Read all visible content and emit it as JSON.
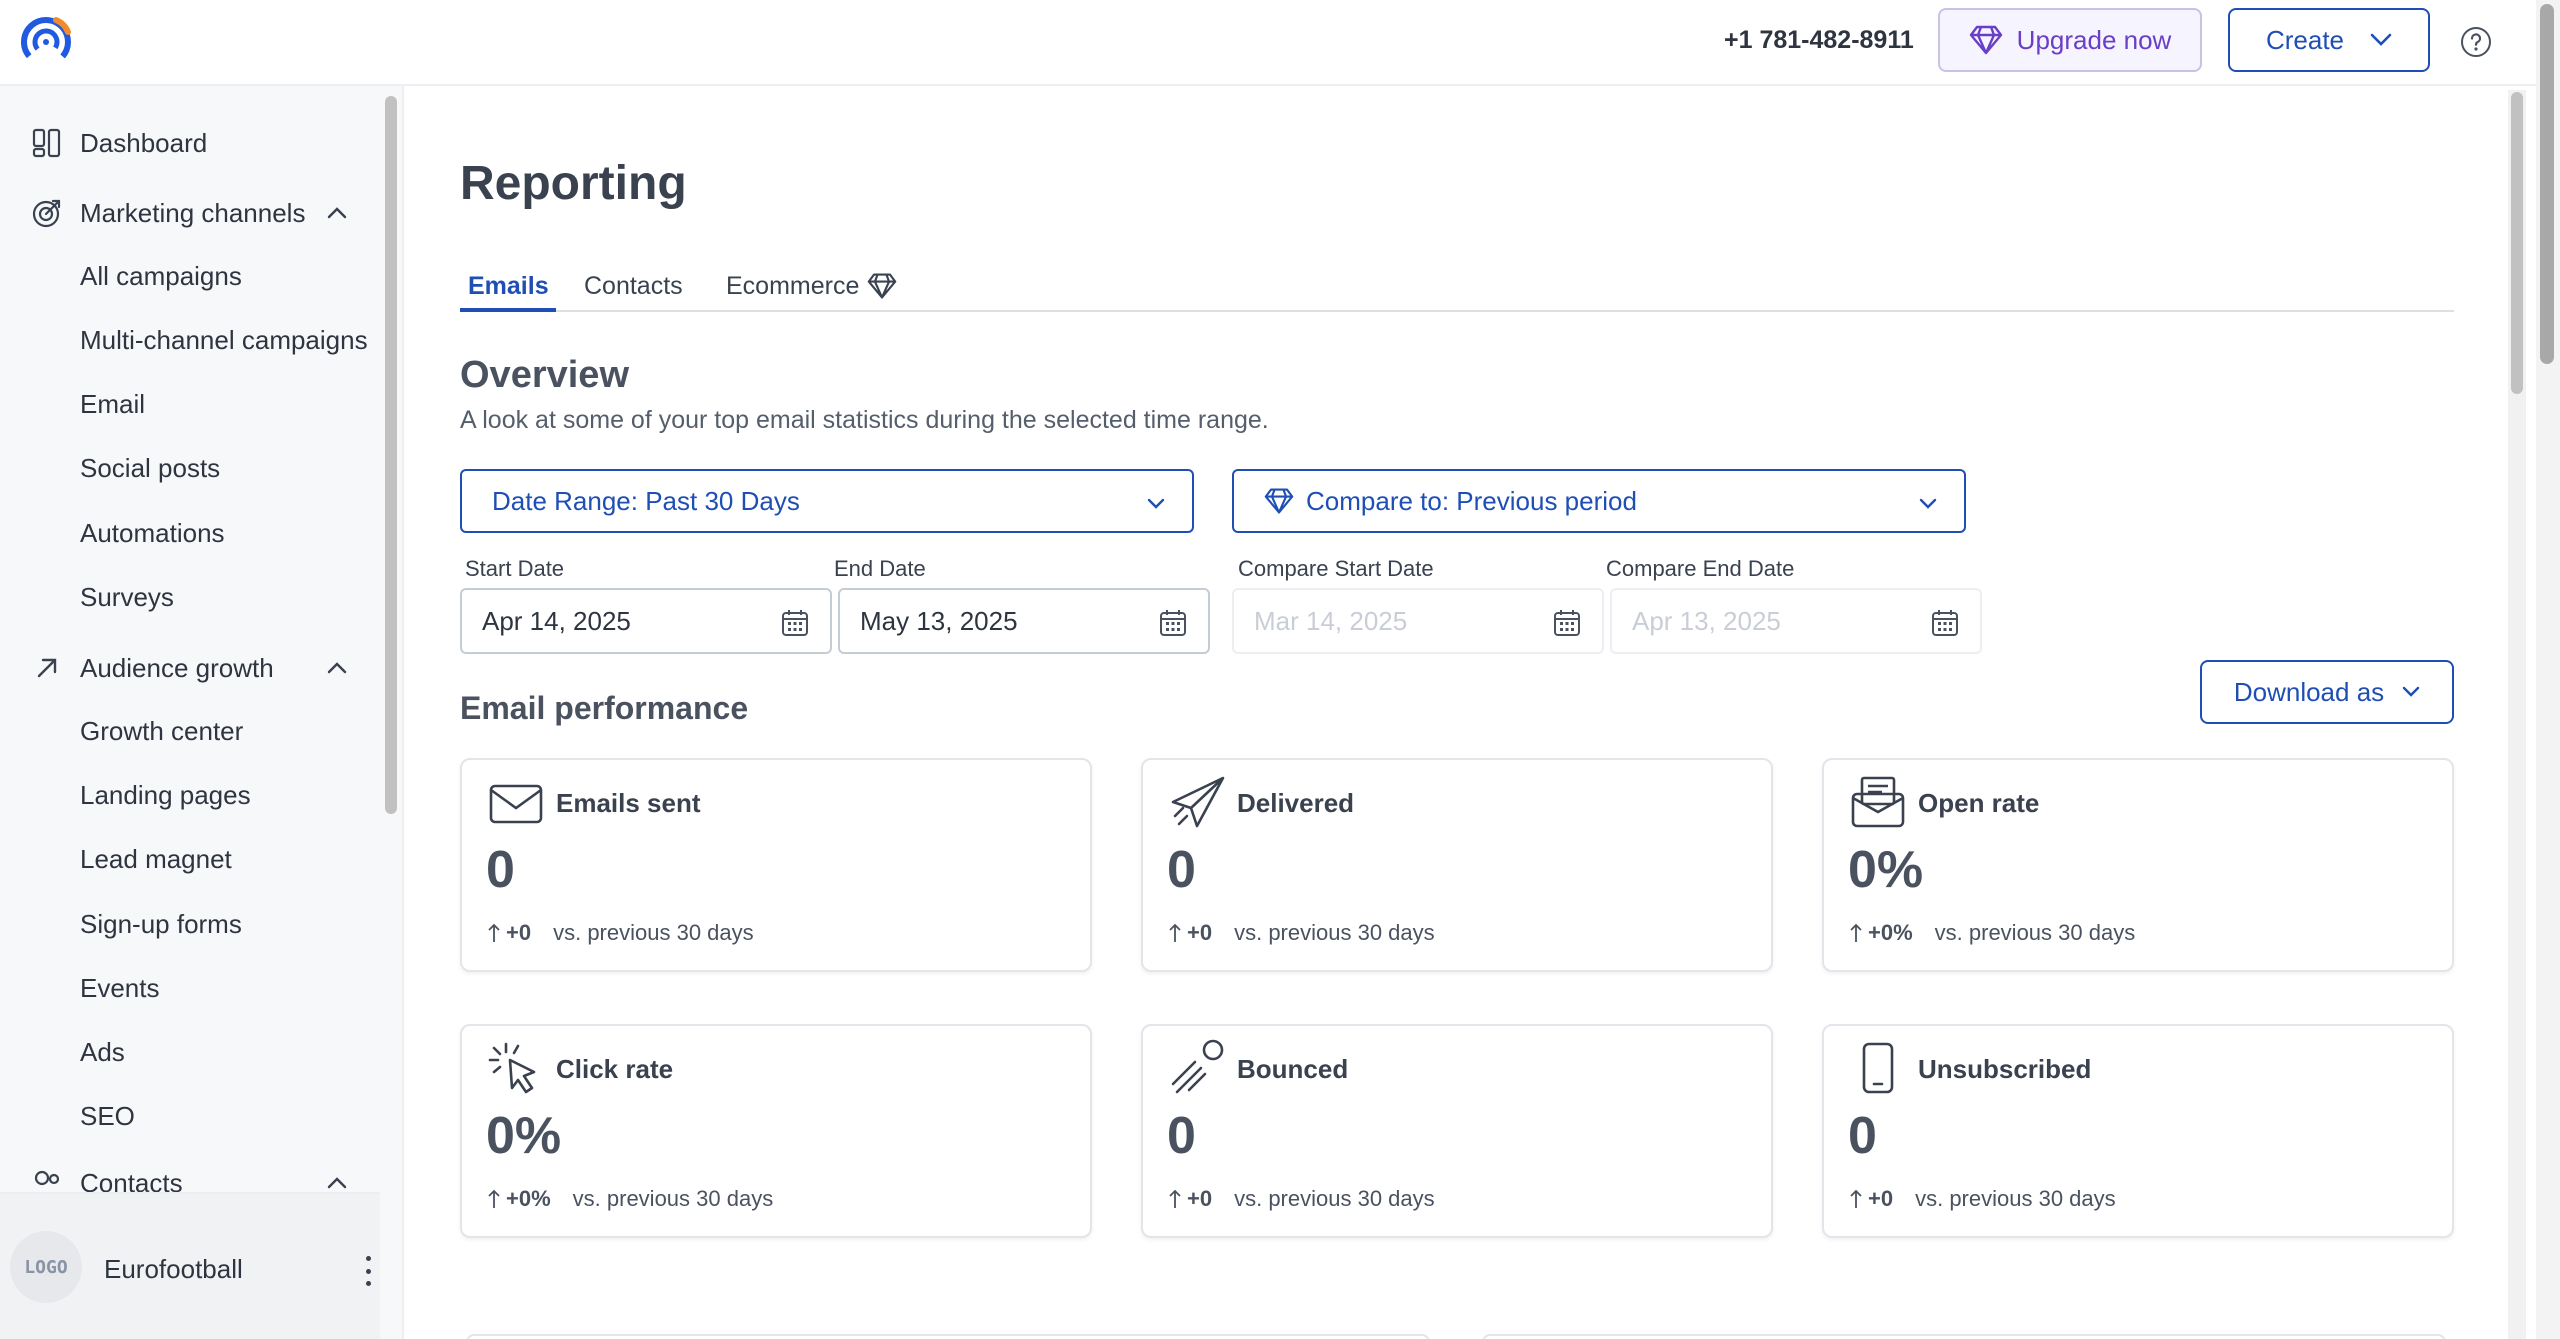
{
  "header": {
    "phone": "+1 781-482-8911",
    "upgrade_label": "Upgrade now",
    "create_label": "Create"
  },
  "sidebar": {
    "items": [
      {
        "label": "Dashboard",
        "icon": "dashboard-icon"
      },
      {
        "label": "Marketing channels",
        "icon": "target-icon",
        "expanded": true
      },
      {
        "label": "All campaigns"
      },
      {
        "label": "Multi-channel campaigns"
      },
      {
        "label": "Email"
      },
      {
        "label": "Social posts"
      },
      {
        "label": "Automations"
      },
      {
        "label": "Surveys"
      },
      {
        "label": "Audience growth",
        "icon": "arrow-up-right-icon",
        "expanded": true
      },
      {
        "label": "Growth center"
      },
      {
        "label": "Landing pages"
      },
      {
        "label": "Lead magnet"
      },
      {
        "label": "Sign-up forms"
      },
      {
        "label": "Events"
      },
      {
        "label": "Ads"
      },
      {
        "label": "SEO"
      },
      {
        "label": "Contacts",
        "icon": "contacts-icon",
        "expanded": true
      }
    ],
    "footer": {
      "logo_text": "LOGO",
      "account_name": "Eurofootball"
    }
  },
  "main": {
    "title": "Reporting",
    "tabs": [
      {
        "label": "Emails",
        "active": true
      },
      {
        "label": "Contacts",
        "active": false
      },
      {
        "label": "Ecommerce",
        "active": false,
        "premium": true
      }
    ],
    "overview": {
      "title": "Overview",
      "description": "A look at some of your top email statistics during the selected time range."
    },
    "date_range_label": "Date Range: Past 30 Days",
    "compare_label": "Compare to: Previous period",
    "dates": {
      "start_label": "Start Date",
      "start_value": "Apr 14, 2025",
      "end_label": "End Date",
      "end_value": "May 13, 2025",
      "compare_start_label": "Compare Start Date",
      "compare_start_placeholder": "Mar 14, 2025",
      "compare_end_label": "Compare End Date",
      "compare_end_placeholder": "Apr 13, 2025"
    },
    "performance": {
      "title": "Email performance",
      "download_label": "Download as",
      "cards": [
        {
          "name": "Emails sent",
          "value": "0",
          "delta": "+0",
          "compare": "vs. previous 30 days",
          "icon": "envelope-icon"
        },
        {
          "name": "Delivered",
          "value": "0",
          "delta": "+0",
          "compare": "vs. previous 30 days",
          "icon": "paper-plane-icon"
        },
        {
          "name": "Open rate",
          "value": "0%",
          "delta": "+0%",
          "compare": "vs. previous 30 days",
          "icon": "open-envelope-icon"
        },
        {
          "name": "Click rate",
          "value": "0%",
          "delta": "+0%",
          "compare": "vs. previous 30 days",
          "icon": "cursor-click-icon"
        },
        {
          "name": "Bounced",
          "value": "0",
          "delta": "+0",
          "compare": "vs. previous 30 days",
          "icon": "bounce-ball-icon"
        },
        {
          "name": "Unsubscribed",
          "value": "0",
          "delta": "+0",
          "compare": "vs. previous 30 days",
          "icon": "mobile-device-icon"
        }
      ]
    }
  },
  "colors": {
    "primary": "#1f4fb5",
    "premium": "#6a3fc7",
    "text": "#2f3540",
    "sidebar_bg": "#f7f8fa"
  }
}
